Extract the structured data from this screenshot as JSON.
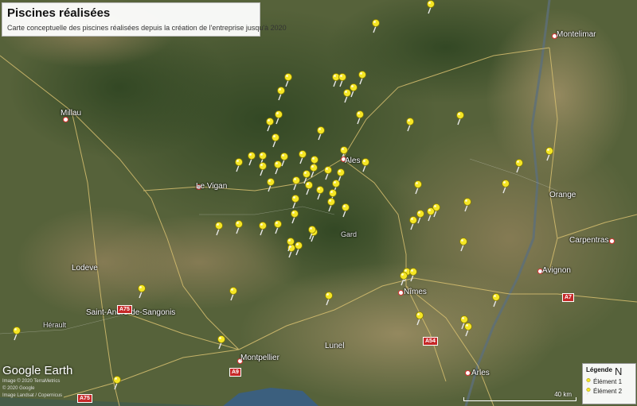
{
  "title": {
    "heading": "Piscines réalisées",
    "subtitle": "Carte conceptuelle des piscines réalisées depuis la création de l'entreprise jusqu'à 2020"
  },
  "cities": [
    {
      "name": "Montelimar"
    },
    {
      "name": "Millau"
    },
    {
      "name": "Ales"
    },
    {
      "name": "Le Vigan"
    },
    {
      "name": "Orange"
    },
    {
      "name": "Carpentras"
    },
    {
      "name": "Lodeve"
    },
    {
      "name": "Avignon"
    },
    {
      "name": "Nîmes"
    },
    {
      "name": "Saint-André-de-Sangonis"
    },
    {
      "name": "Hérault"
    },
    {
      "name": "Montpellier"
    },
    {
      "name": "Lunel"
    },
    {
      "name": "Arles"
    },
    {
      "name": "Gard"
    }
  ],
  "roads": [
    "A75",
    "A9",
    "A54",
    "A7"
  ],
  "pin_color": "#f5e625",
  "pin_count": 72,
  "logo": "Google Earth",
  "attribution": [
    "Image © 2020 TerraMetrics",
    "© 2020 Google",
    "Image Landsat / Copernicus"
  ],
  "legend": {
    "title": "Légende",
    "items": [
      {
        "label": "Élément 1"
      },
      {
        "label": "Élément 2"
      }
    ]
  },
  "scale_label": "40 km",
  "compass_label": "N"
}
